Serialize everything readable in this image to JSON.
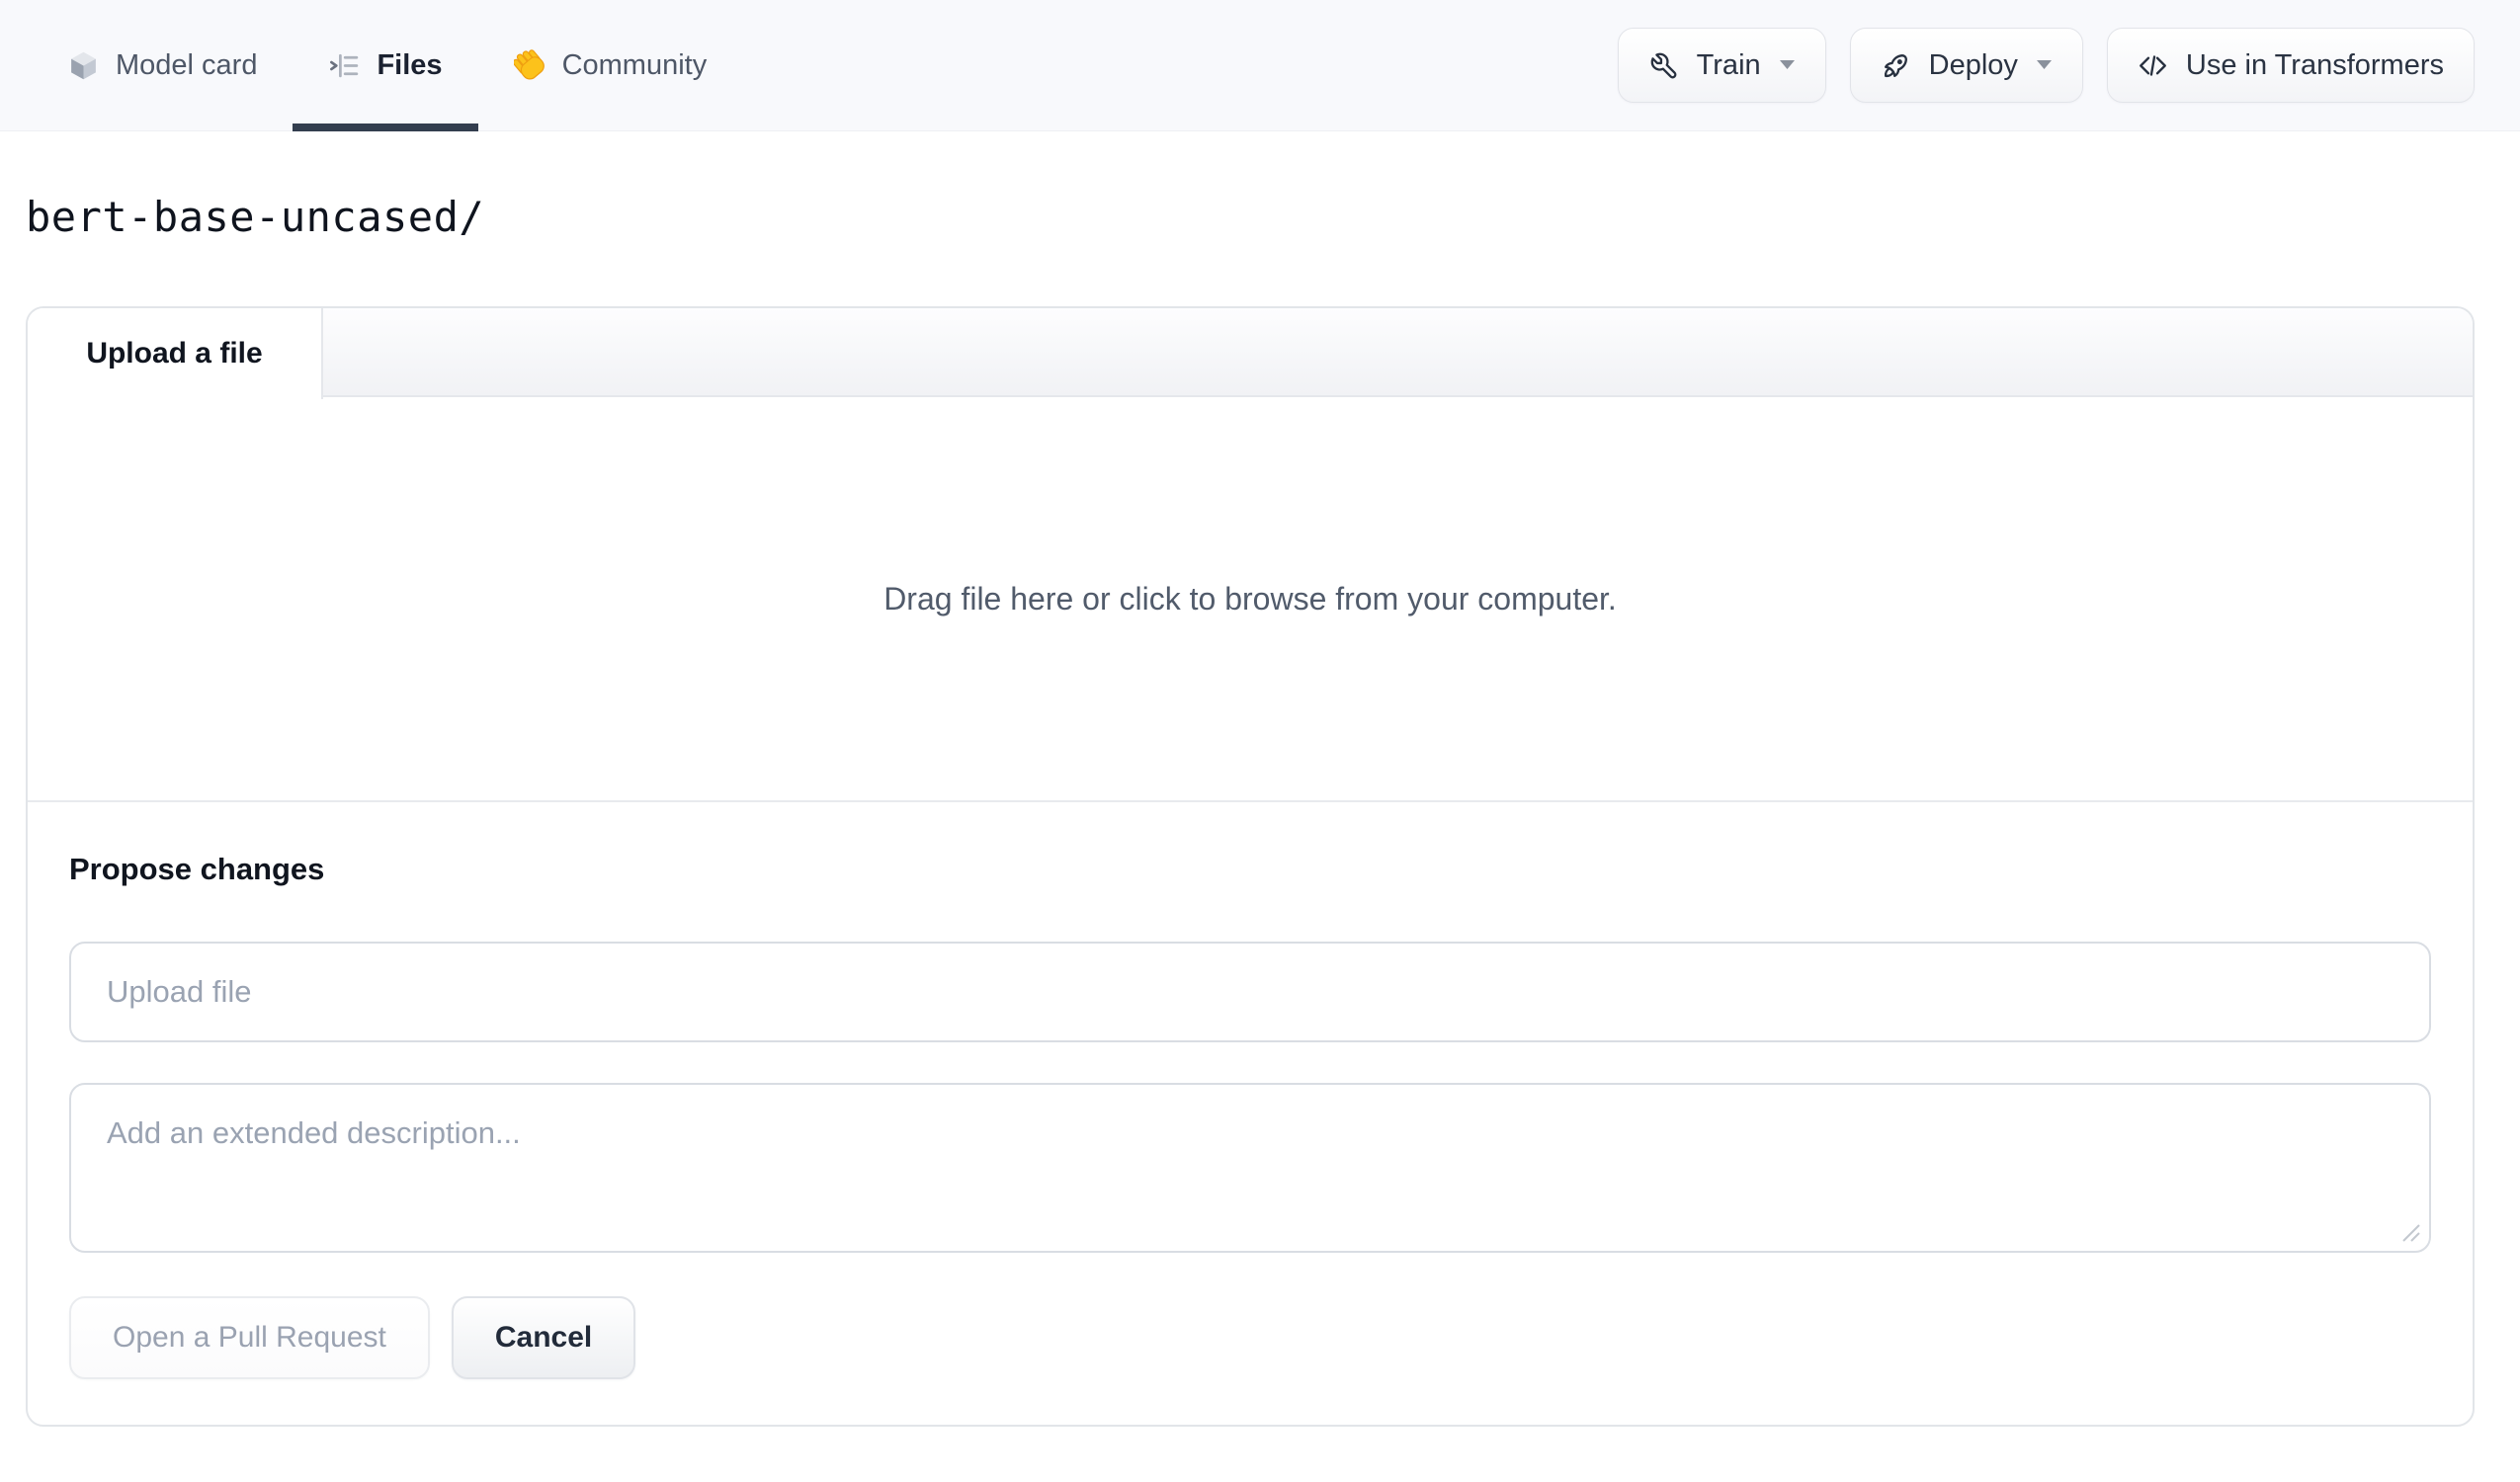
{
  "header": {
    "tabs": [
      {
        "label": "Model card",
        "icon": "cube-icon",
        "active": false
      },
      {
        "label": "Files",
        "icon": "files-list-icon",
        "active": true
      },
      {
        "label": "Community",
        "icon": "waving-hand-icon",
        "active": false
      }
    ],
    "actions": [
      {
        "label": "Train",
        "icon": "wrench-icon",
        "has_dropdown": true
      },
      {
        "label": "Deploy",
        "icon": "rocket-icon",
        "has_dropdown": true
      },
      {
        "label": "Use in Transformers",
        "icon": "code-icon",
        "has_dropdown": false
      }
    ]
  },
  "breadcrumb": {
    "path": "bert-base-uncased/"
  },
  "upload_panel": {
    "tab_label": "Upload a file",
    "dropzone_text": "Drag file here or click to browse from your computer.",
    "propose": {
      "heading": "Propose changes",
      "file_input_placeholder": "Upload file",
      "description_placeholder": "Add an extended description...",
      "submit_label": "Open a Pull Request",
      "cancel_label": "Cancel"
    }
  },
  "colors": {
    "header_bg": "#f8f9fc",
    "tab_underline": "#333e4f",
    "active_text": "#1a2130",
    "inactive_text": "#4e5767",
    "panel_border": "#e2e5e9",
    "input_border": "#d9dde3",
    "placeholder_text": "#9aa3b2",
    "dropzone_text": "#515b6b",
    "disabled_button_text": "#9aa2b1",
    "hand_emoji_fill": "#fcc21b"
  }
}
